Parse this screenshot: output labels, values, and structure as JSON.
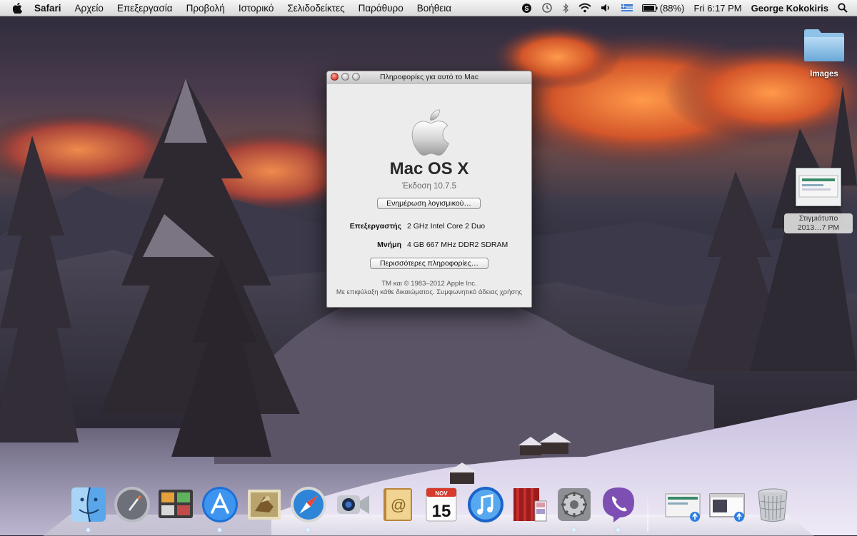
{
  "menubar": {
    "app": "Safari",
    "items": [
      "Αρχείο",
      "Επεξεργασία",
      "Προβολή",
      "Ιστορικό",
      "Σελιδοδείκτες",
      "Παράθυρο",
      "Βοήθεια"
    ],
    "battery": "(88%)",
    "clock": "Fri 6:17 PM",
    "user": "George Kokokiris"
  },
  "about": {
    "title": "Πληροφορίες για αυτό το Mac",
    "os_name": "Mac OS X",
    "version": "Έκδοση 10.7.5",
    "update_button": "Ενημέρωση λογισμικού…",
    "cpu_label": "Επεξεργαστής",
    "cpu_value": "2 GHz Intel Core 2 Duo",
    "memory_label": "Μνήμη",
    "memory_value": "4 GB 667 MHz  DDR2 SDRAM",
    "more_button": "Περισσότερες πληροφορίες…",
    "legal_1": "TM και © 1983–2012 Apple Inc.",
    "legal_2": "Με επιφύλαξη κάθε δικαιώματος. Συμφωνητικό άδειας χρήσης"
  },
  "desktop": {
    "folder_label": "Images",
    "screenshot_label_1": "Στιγμιότυπο",
    "screenshot_label_2": "2013…7 PM"
  },
  "dock": {
    "calendar_month": "NOV",
    "calendar_day": "15",
    "items": [
      "finder-icon",
      "launchpad-icon",
      "preview-icon",
      "app-store-icon",
      "mail-icon",
      "safari-icon",
      "facetime-icon",
      "address-book-icon",
      "ical-icon",
      "itunes-icon",
      "photo-booth-icon",
      "system-preferences-icon",
      "viber-icon",
      "screenshot-stack-icon",
      "window-stack-icon",
      "trash-icon"
    ]
  }
}
